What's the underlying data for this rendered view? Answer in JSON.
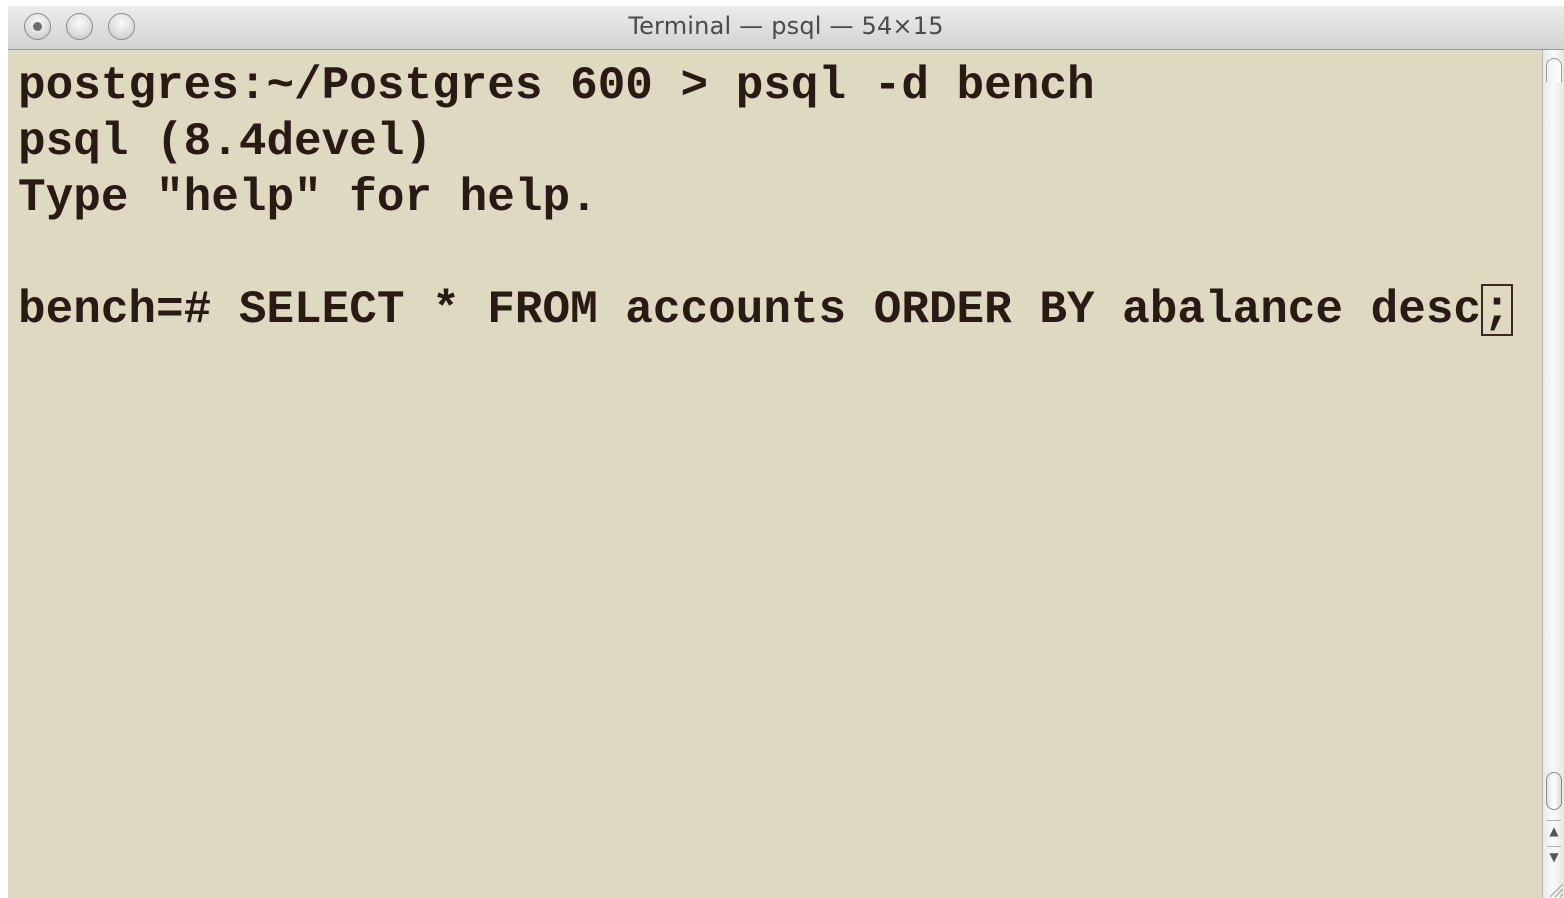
{
  "window": {
    "title": "Terminal — psql — 54×15"
  },
  "terminal": {
    "lines": [
      "postgres:~/Postgres 600 > psql -d bench",
      "psql (8.4devel)",
      "Type \"help\" for help.",
      ""
    ],
    "prompt_line": {
      "text": "bench=# SELECT * FROM accounts ORDER BY abalance desc",
      "cursor_char": ";"
    },
    "colors": {
      "background": "#dfd9c2",
      "foreground": "#2a1a14"
    }
  },
  "scrollbar": {
    "up_arrow": "▲",
    "down_arrow": "▼"
  },
  "icons": {
    "close": "close-icon",
    "minimize": "minimize-icon",
    "zoom": "zoom-icon",
    "resize": "resize-grip-icon"
  }
}
